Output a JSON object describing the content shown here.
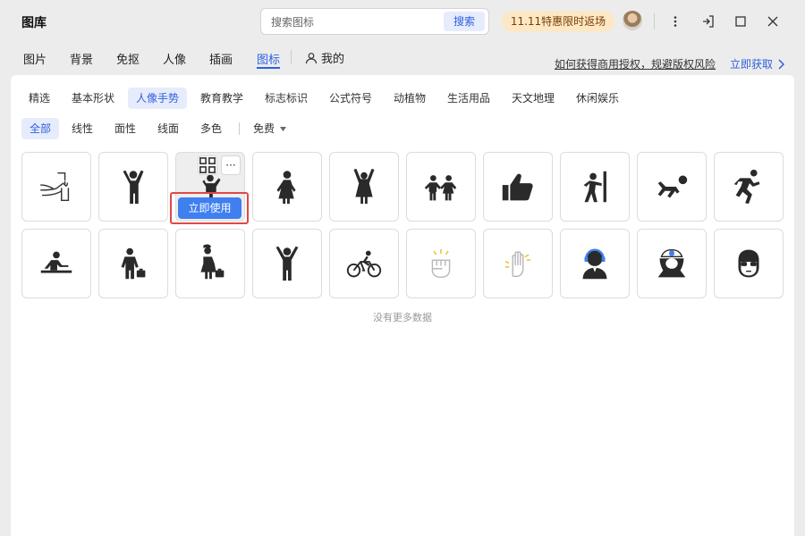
{
  "app": {
    "title": "图库"
  },
  "search": {
    "placeholder": "搜索图标",
    "value": "",
    "button_label": "搜索"
  },
  "promo": {
    "label": "11.11特惠限时返场"
  },
  "nav": {
    "tabs": [
      {
        "label": "图片"
      },
      {
        "label": "背景"
      },
      {
        "label": "免抠"
      },
      {
        "label": "人像"
      },
      {
        "label": "插画"
      },
      {
        "label": "图标",
        "active": true
      }
    ],
    "mine_label": "我的",
    "license_link": "如何获得商用授权，规避版权风险",
    "get_now_label": "立即获取"
  },
  "categories": [
    {
      "label": "精选"
    },
    {
      "label": "基本形状"
    },
    {
      "label": "人像手势",
      "active": true
    },
    {
      "label": "教育教学"
    },
    {
      "label": "标志标识"
    },
    {
      "label": "公式符号"
    },
    {
      "label": "动植物"
    },
    {
      "label": "生活用品"
    },
    {
      "label": "天文地理"
    },
    {
      "label": "休闲娱乐"
    }
  ],
  "filters": {
    "styles": [
      {
        "label": "全部",
        "active": true
      },
      {
        "label": "线性"
      },
      {
        "label": "面性"
      },
      {
        "label": "线面"
      },
      {
        "label": "多色"
      }
    ],
    "price_label": "免费"
  },
  "hover_card": {
    "use_label": "立即使用",
    "more_label": "···"
  },
  "icons": [
    {
      "name": "person-washing-hands-icon"
    },
    {
      "name": "person-arms-raised-icon"
    },
    {
      "name": "person-waving-icon"
    },
    {
      "name": "woman-standing-icon"
    },
    {
      "name": "woman-arms-raised-icon"
    },
    {
      "name": "children-holding-hands-icon"
    },
    {
      "name": "thumbs-up-icon"
    },
    {
      "name": "person-pushing-wall-icon"
    },
    {
      "name": "person-crawling-icon"
    },
    {
      "name": "person-running-icon"
    },
    {
      "name": "person-at-desk-icon"
    },
    {
      "name": "businessman-briefcase-icon"
    },
    {
      "name": "businesswoman-briefcase-icon"
    },
    {
      "name": "person-cheering-icon"
    },
    {
      "name": "person-cycling-icon"
    },
    {
      "name": "raised-fist-icon"
    },
    {
      "name": "raised-palm-icon"
    },
    {
      "name": "customer-service-agent-icon"
    },
    {
      "name": "nurse-icon"
    },
    {
      "name": "person-sunglasses-icon"
    }
  ],
  "footer": {
    "no_more_text": "没有更多数据"
  },
  "colors": {
    "accent": "#2f5fe0",
    "button_blue": "#3f7ff0",
    "highlight_red": "#e04848",
    "promo_bg": "#fce8c6",
    "icon_dark": "#2a2a2a"
  }
}
